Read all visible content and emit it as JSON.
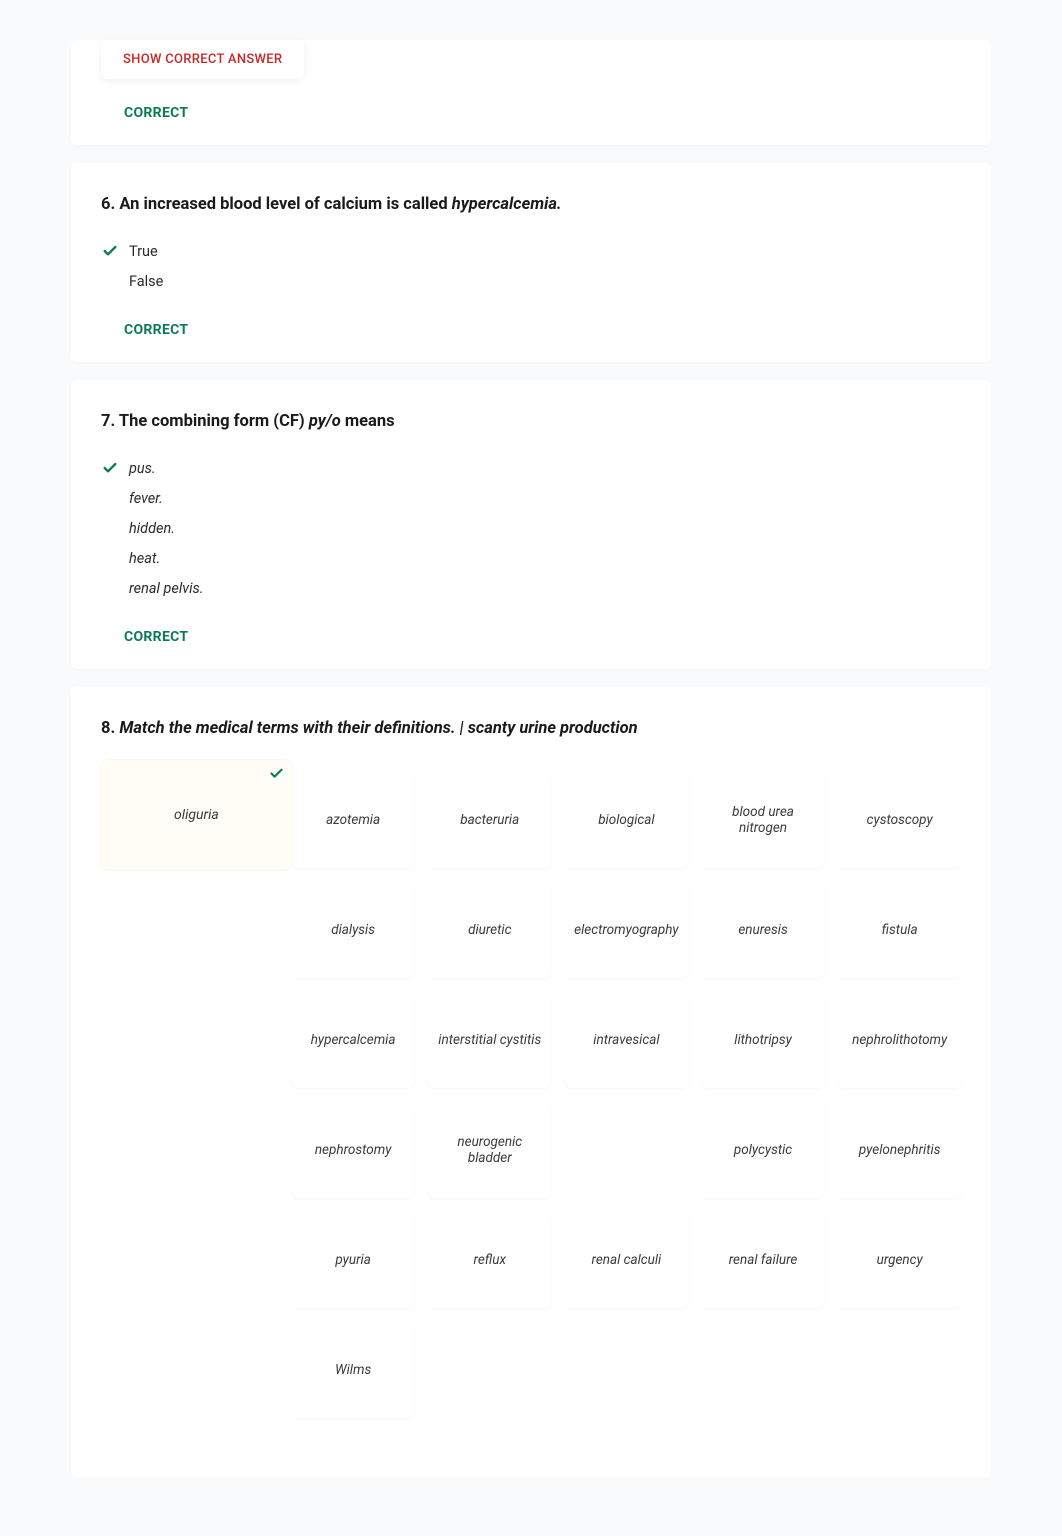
{
  "show_answer_button": "SHOW CORRECT ANSWER",
  "correct_label": "CORRECT",
  "q6": {
    "title_plain": "6. An increased blood level of calcium is called ",
    "title_em": "hypercalcemia.",
    "options": [
      {
        "text": "True",
        "correct": true,
        "italic": false
      },
      {
        "text": "False",
        "correct": false,
        "italic": false
      }
    ]
  },
  "q7": {
    "title_prefix": "7. The combining form (CF) ",
    "title_em": "py/o",
    "title_suffix": " means",
    "options": [
      {
        "text": "pus.",
        "correct": true,
        "italic": true
      },
      {
        "text": "fever.",
        "correct": false,
        "italic": true
      },
      {
        "text": "hidden.",
        "correct": false,
        "italic": true
      },
      {
        "text": "heat.",
        "correct": false,
        "italic": true
      },
      {
        "text": "renal pelvis.",
        "correct": false,
        "italic": true
      }
    ]
  },
  "q8": {
    "title_prefix": "8. ",
    "title_em": "Match the medical terms with their definitions. | scanty urine production",
    "drop_answer": "oliguria",
    "terms": [
      "azotemia",
      "bacteruria",
      "biological",
      "blood urea nitrogen",
      "cystoscopy",
      "dialysis",
      "diuretic",
      "electromyography",
      "enuresis",
      "fistula",
      "hypercalcemia",
      "interstitial cystitis",
      "intravesical",
      "lithotripsy",
      "nephrolithotomy",
      "nephrostomy",
      "neurogenic bladder",
      "",
      "polycystic",
      "pyelonephritis",
      "pyuria",
      "reflux",
      "renal calculi",
      "renal failure",
      "urgency",
      "Wilms",
      "",
      "",
      "",
      ""
    ]
  }
}
